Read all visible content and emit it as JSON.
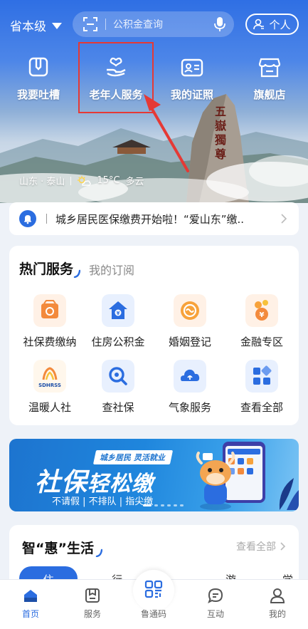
{
  "header": {
    "region": "省本级",
    "search_placeholder": "公积金查询",
    "personal_label": "个人"
  },
  "quick_actions": [
    {
      "label": "我要吐槽",
      "icon": "feedback-icon"
    },
    {
      "label": "老年人服务",
      "icon": "elderly-care-icon"
    },
    {
      "label": "我的证照",
      "icon": "id-card-icon"
    },
    {
      "label": "旗舰店",
      "icon": "store-icon"
    }
  ],
  "weather": {
    "location": "山东 · 泰山",
    "temperature": "15°C",
    "condition": "多云"
  },
  "notice": {
    "text": "城乡居民医保缴费开始啦！“爱山东”缴.."
  },
  "hot_services": {
    "tab_active": "热门服务",
    "tab_other": "我的订阅",
    "items": [
      {
        "label": "社保费缴纳",
        "icon": "social-insurance-pay-icon"
      },
      {
        "label": "住房公积金",
        "icon": "housing-fund-icon"
      },
      {
        "label": "婚姻登记",
        "icon": "marriage-registration-icon"
      },
      {
        "label": "金融专区",
        "icon": "finance-icon"
      },
      {
        "label": "温暖人社",
        "icon": "sdhrss-logo-icon"
      },
      {
        "label": "查社保",
        "icon": "social-insurance-search-icon"
      },
      {
        "label": "气象服务",
        "icon": "weather-service-icon"
      },
      {
        "label": "查看全部",
        "icon": "all-services-icon"
      }
    ]
  },
  "banner": {
    "tag": "城乡居民 灵活就业",
    "title_a": "社保",
    "title_b": "轻松缴",
    "subtitle": "不请假 | 不排队 | 指尖缴"
  },
  "smart_life": {
    "title": "智“惠”生活",
    "view_all": "查看全部",
    "tabs": [
      "住",
      "行",
      "游",
      "学"
    ]
  },
  "tabbar": [
    {
      "label": "首页",
      "active": true
    },
    {
      "label": "服务",
      "active": false
    },
    {
      "label": "鲁通码",
      "active": false
    },
    {
      "label": "互动",
      "active": false
    },
    {
      "label": "我的",
      "active": false
    }
  ],
  "colors": {
    "primary": "#2b6de0",
    "annotation": "#e53935",
    "banner": "#1d74cf"
  }
}
